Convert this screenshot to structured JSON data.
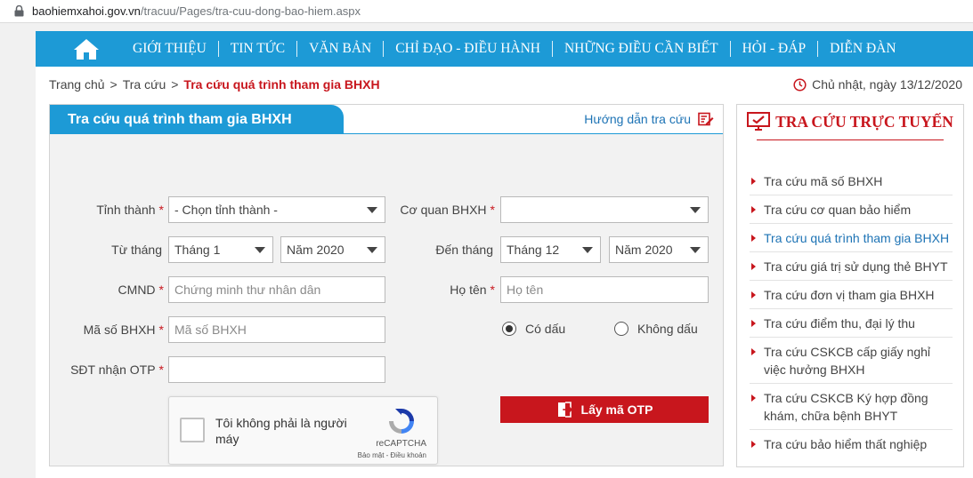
{
  "browser": {
    "domain": "baohiemxahoi.gov.vn",
    "path": "/tracuu/Pages/tra-cuu-dong-bao-hiem.aspx"
  },
  "nav": {
    "items": [
      "GIỚI THIỆU",
      "TIN TỨC",
      "VĂN BẢN",
      "CHỈ ĐẠO - ĐIỀU HÀNH",
      "NHỮNG ĐIỀU CẦN BIẾT",
      "HỎI - ĐÁP",
      "DIỄN ĐÀN"
    ]
  },
  "breadcrumb": {
    "home": "Trang chủ",
    "section": "Tra cứu",
    "current": "Tra cứu quá trình tham gia BHXH",
    "separator": ">"
  },
  "date": "Chủ nhật, ngày 13/12/2020",
  "form": {
    "title": "Tra cứu quá trình tham gia BHXH",
    "guide": "Hướng dẫn tra cứu",
    "required_mark": "*",
    "province_label": "Tỉnh thành",
    "province_value": "- Chọn tỉnh thành -",
    "agency_label": "Cơ quan BHXH",
    "agency_value": "",
    "from_label": "Từ tháng",
    "from_month": "Tháng 1",
    "from_year": "Năm 2020",
    "to_label": "Đến tháng",
    "to_month": "Tháng 12",
    "to_year": "Năm 2020",
    "id_label": "CMND",
    "id_placeholder": "Chứng minh thư nhân dân",
    "name_label": "Họ tên",
    "name_placeholder": "Họ tên",
    "ssn_label": "Mã số BHXH",
    "ssn_placeholder": "Mã số BHXH",
    "phone_label": "SĐT nhận OTP",
    "phone_value": "",
    "radio_accent": "Có dấu",
    "radio_noaccent": "Không dấu",
    "radio_selected": "Có dấu",
    "captcha_text": "Tôi không phải là người máy",
    "captcha_brand": "reCAPTCHA",
    "captcha_privacy": "Bảo mật - Điều khoản",
    "otp_button": "Lấy mã OTP"
  },
  "sidebar": {
    "title": "TRA CỨU TRỰC TUYẾN",
    "items": [
      "Tra cứu mã số BHXH",
      "Tra cứu cơ quan bảo hiểm",
      "Tra cứu quá trình tham gia BHXH",
      "Tra cứu giá trị sử dụng thẻ BHYT",
      "Tra cứu đơn vị tham gia BHXH",
      "Tra cứu điểm thu, đại lý thu",
      "Tra cứu CSKCB cấp giấy nghỉ việc hưởng BHXH",
      "Tra cứu CSKCB Ký hợp đồng khám, chữa bệnh BHYT",
      "Tra cứu bảo hiểm thất nghiệp"
    ],
    "active_index": 2
  },
  "colors": {
    "nav_blue": "#1d9ad6",
    "accent_red": "#c8161d",
    "link_blue": "#1d73b5"
  }
}
